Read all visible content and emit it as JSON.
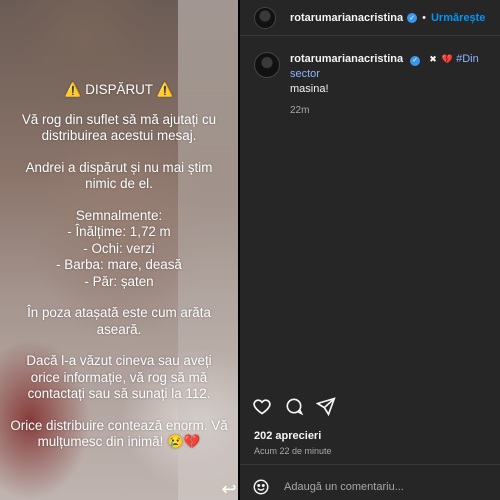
{
  "story": {
    "title": "⚠️ DISPĂRUT ⚠️",
    "paragraph1": "Vă rog din suflet să mă ajutați cu distribuirea acestui mesaj.",
    "paragraph2": "Andrei a dispărut și nu mai știm nimic de el.",
    "signs_title": "Semnalmente:",
    "signs": [
      "- Înălțime: 1,72 m",
      "- Ochi: verzi",
      "- Barba: mare, deasă",
      "- Păr: șaten"
    ],
    "paragraph3": "În poza atașată este cum arăta aseară.",
    "paragraph4": "Dacă l-a văzut cineva sau aveți orice informație, vă rog să mă contactați sau să sunați la 112.",
    "paragraph5": "Orice distribuire contează enorm. Vă mulțumesc din inimă! 😢💔"
  },
  "header": {
    "username": "rotarumarianacristina",
    "separator": "•",
    "follow_label": "Urmărește"
  },
  "comment": {
    "username": "rotarumarianacristina",
    "text_start": "#Din sector",
    "text_end": "masina!",
    "time": "22m"
  },
  "post": {
    "likes": "202 aprecieri",
    "time": "Acum 22 de minute"
  },
  "comment_box": {
    "placeholder": "Adaugă un comentariu..."
  },
  "colors": {
    "panel": "#262626",
    "accent": "#0095f6",
    "verified": "#3897f0"
  }
}
